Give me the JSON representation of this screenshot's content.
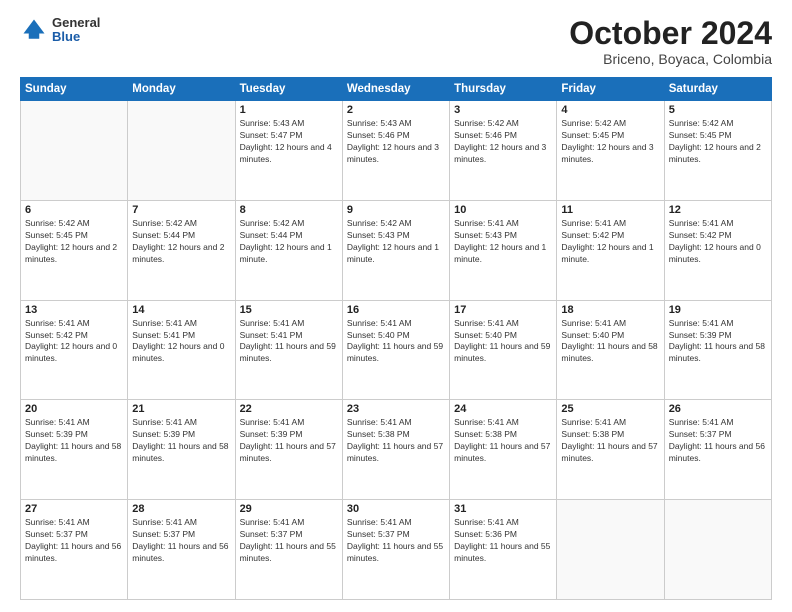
{
  "header": {
    "logo_general": "General",
    "logo_blue": "Blue",
    "month_title": "October 2024",
    "location": "Briceno, Boyaca, Colombia"
  },
  "days_of_week": [
    "Sunday",
    "Monday",
    "Tuesday",
    "Wednesday",
    "Thursday",
    "Friday",
    "Saturday"
  ],
  "weeks": [
    [
      {
        "day": "",
        "empty": true
      },
      {
        "day": "",
        "empty": true
      },
      {
        "day": "1",
        "sunrise": "Sunrise: 5:43 AM",
        "sunset": "Sunset: 5:47 PM",
        "daylight": "Daylight: 12 hours and 4 minutes."
      },
      {
        "day": "2",
        "sunrise": "Sunrise: 5:43 AM",
        "sunset": "Sunset: 5:46 PM",
        "daylight": "Daylight: 12 hours and 3 minutes."
      },
      {
        "day": "3",
        "sunrise": "Sunrise: 5:42 AM",
        "sunset": "Sunset: 5:46 PM",
        "daylight": "Daylight: 12 hours and 3 minutes."
      },
      {
        "day": "4",
        "sunrise": "Sunrise: 5:42 AM",
        "sunset": "Sunset: 5:45 PM",
        "daylight": "Daylight: 12 hours and 3 minutes."
      },
      {
        "day": "5",
        "sunrise": "Sunrise: 5:42 AM",
        "sunset": "Sunset: 5:45 PM",
        "daylight": "Daylight: 12 hours and 2 minutes."
      }
    ],
    [
      {
        "day": "6",
        "sunrise": "Sunrise: 5:42 AM",
        "sunset": "Sunset: 5:45 PM",
        "daylight": "Daylight: 12 hours and 2 minutes."
      },
      {
        "day": "7",
        "sunrise": "Sunrise: 5:42 AM",
        "sunset": "Sunset: 5:44 PM",
        "daylight": "Daylight: 12 hours and 2 minutes."
      },
      {
        "day": "8",
        "sunrise": "Sunrise: 5:42 AM",
        "sunset": "Sunset: 5:44 PM",
        "daylight": "Daylight: 12 hours and 1 minute."
      },
      {
        "day": "9",
        "sunrise": "Sunrise: 5:42 AM",
        "sunset": "Sunset: 5:43 PM",
        "daylight": "Daylight: 12 hours and 1 minute."
      },
      {
        "day": "10",
        "sunrise": "Sunrise: 5:41 AM",
        "sunset": "Sunset: 5:43 PM",
        "daylight": "Daylight: 12 hours and 1 minute."
      },
      {
        "day": "11",
        "sunrise": "Sunrise: 5:41 AM",
        "sunset": "Sunset: 5:42 PM",
        "daylight": "Daylight: 12 hours and 1 minute."
      },
      {
        "day": "12",
        "sunrise": "Sunrise: 5:41 AM",
        "sunset": "Sunset: 5:42 PM",
        "daylight": "Daylight: 12 hours and 0 minutes."
      }
    ],
    [
      {
        "day": "13",
        "sunrise": "Sunrise: 5:41 AM",
        "sunset": "Sunset: 5:42 PM",
        "daylight": "Daylight: 12 hours and 0 minutes."
      },
      {
        "day": "14",
        "sunrise": "Sunrise: 5:41 AM",
        "sunset": "Sunset: 5:41 PM",
        "daylight": "Daylight: 12 hours and 0 minutes."
      },
      {
        "day": "15",
        "sunrise": "Sunrise: 5:41 AM",
        "sunset": "Sunset: 5:41 PM",
        "daylight": "Daylight: 11 hours and 59 minutes."
      },
      {
        "day": "16",
        "sunrise": "Sunrise: 5:41 AM",
        "sunset": "Sunset: 5:40 PM",
        "daylight": "Daylight: 11 hours and 59 minutes."
      },
      {
        "day": "17",
        "sunrise": "Sunrise: 5:41 AM",
        "sunset": "Sunset: 5:40 PM",
        "daylight": "Daylight: 11 hours and 59 minutes."
      },
      {
        "day": "18",
        "sunrise": "Sunrise: 5:41 AM",
        "sunset": "Sunset: 5:40 PM",
        "daylight": "Daylight: 11 hours and 58 minutes."
      },
      {
        "day": "19",
        "sunrise": "Sunrise: 5:41 AM",
        "sunset": "Sunset: 5:39 PM",
        "daylight": "Daylight: 11 hours and 58 minutes."
      }
    ],
    [
      {
        "day": "20",
        "sunrise": "Sunrise: 5:41 AM",
        "sunset": "Sunset: 5:39 PM",
        "daylight": "Daylight: 11 hours and 58 minutes."
      },
      {
        "day": "21",
        "sunrise": "Sunrise: 5:41 AM",
        "sunset": "Sunset: 5:39 PM",
        "daylight": "Daylight: 11 hours and 58 minutes."
      },
      {
        "day": "22",
        "sunrise": "Sunrise: 5:41 AM",
        "sunset": "Sunset: 5:39 PM",
        "daylight": "Daylight: 11 hours and 57 minutes."
      },
      {
        "day": "23",
        "sunrise": "Sunrise: 5:41 AM",
        "sunset": "Sunset: 5:38 PM",
        "daylight": "Daylight: 11 hours and 57 minutes."
      },
      {
        "day": "24",
        "sunrise": "Sunrise: 5:41 AM",
        "sunset": "Sunset: 5:38 PM",
        "daylight": "Daylight: 11 hours and 57 minutes."
      },
      {
        "day": "25",
        "sunrise": "Sunrise: 5:41 AM",
        "sunset": "Sunset: 5:38 PM",
        "daylight": "Daylight: 11 hours and 57 minutes."
      },
      {
        "day": "26",
        "sunrise": "Sunrise: 5:41 AM",
        "sunset": "Sunset: 5:37 PM",
        "daylight": "Daylight: 11 hours and 56 minutes."
      }
    ],
    [
      {
        "day": "27",
        "sunrise": "Sunrise: 5:41 AM",
        "sunset": "Sunset: 5:37 PM",
        "daylight": "Daylight: 11 hours and 56 minutes."
      },
      {
        "day": "28",
        "sunrise": "Sunrise: 5:41 AM",
        "sunset": "Sunset: 5:37 PM",
        "daylight": "Daylight: 11 hours and 56 minutes."
      },
      {
        "day": "29",
        "sunrise": "Sunrise: 5:41 AM",
        "sunset": "Sunset: 5:37 PM",
        "daylight": "Daylight: 11 hours and 55 minutes."
      },
      {
        "day": "30",
        "sunrise": "Sunrise: 5:41 AM",
        "sunset": "Sunset: 5:37 PM",
        "daylight": "Daylight: 11 hours and 55 minutes."
      },
      {
        "day": "31",
        "sunrise": "Sunrise: 5:41 AM",
        "sunset": "Sunset: 5:36 PM",
        "daylight": "Daylight: 11 hours and 55 minutes."
      },
      {
        "day": "",
        "empty": true
      },
      {
        "day": "",
        "empty": true
      }
    ]
  ]
}
